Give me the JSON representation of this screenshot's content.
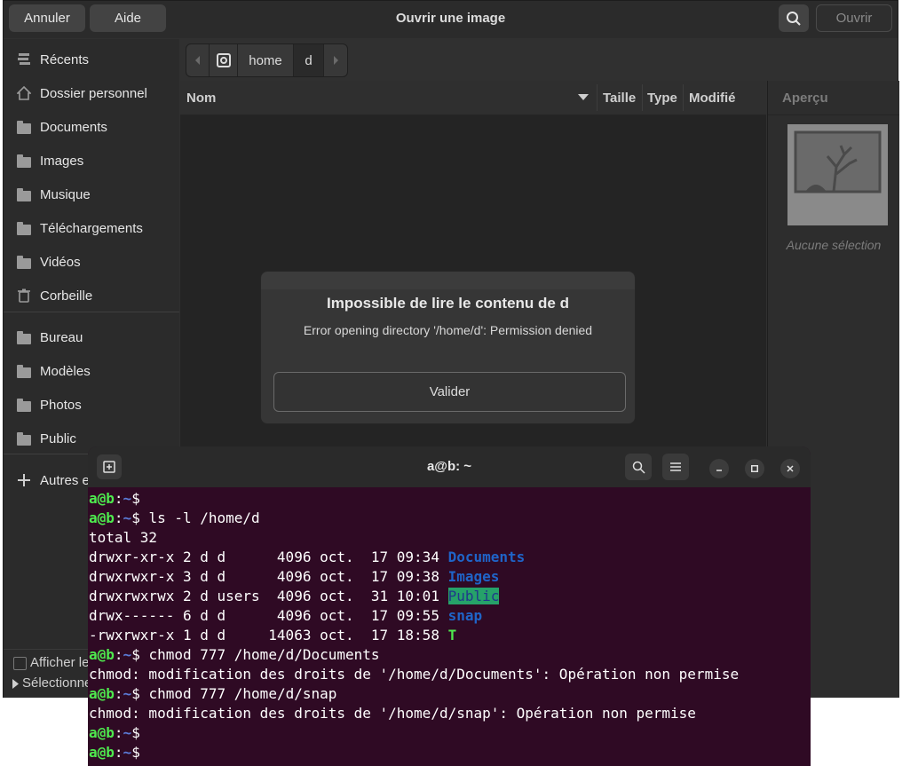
{
  "chooser": {
    "title": "Ouvrir une image",
    "cancel": "Annuler",
    "help": "Aide",
    "open": "Ouvrir",
    "sidebar": [
      {
        "label": "Récents",
        "icon": "recent-icon"
      },
      {
        "label": "Dossier personnel",
        "icon": "home-icon"
      },
      {
        "label": "Documents",
        "icon": "folder-icon"
      },
      {
        "label": "Images",
        "icon": "folder-icon"
      },
      {
        "label": "Musique",
        "icon": "folder-icon"
      },
      {
        "label": "Téléchargements",
        "icon": "folder-icon"
      },
      {
        "label": "Vidéos",
        "icon": "folder-icon"
      },
      {
        "label": "Corbeille",
        "icon": "trash-icon"
      },
      {
        "label": "Bureau",
        "icon": "folder-icon"
      },
      {
        "label": "Modèles",
        "icon": "folder-icon"
      },
      {
        "label": "Photos",
        "icon": "folder-icon"
      },
      {
        "label": "Public",
        "icon": "folder-icon"
      },
      {
        "label": "Autres emplacements",
        "icon": "plus-icon"
      }
    ],
    "path": [
      "home",
      "d"
    ],
    "columns": {
      "name": "Nom",
      "size": "Taille",
      "type": "Type",
      "modified": "Modifié"
    },
    "preview_header": "Aperçu",
    "preview_empty": "Aucune sélection",
    "show_hidden": "Afficher les fichiers cachés",
    "selection": "Sélectionner"
  },
  "dialog": {
    "title": "Impossible de lire le contenu de d",
    "message": "Error opening directory '/home/d': Permission denied",
    "button": "Valider"
  },
  "terminal": {
    "title": "a@b: ~",
    "lines": [
      {
        "type": "prompt",
        "cmd": ""
      },
      {
        "type": "prompt",
        "cmd": "ls -l /home/d"
      },
      {
        "type": "out",
        "text": "total 32"
      },
      {
        "type": "ls",
        "perms": "drwxr-xr-x 2 d d      4096 oct.  17 09:34 ",
        "name": "Documents",
        "style": "dir"
      },
      {
        "type": "ls",
        "perms": "drwxrwxr-x 3 d d      4096 oct.  17 09:38 ",
        "name": "Images",
        "style": "dir"
      },
      {
        "type": "ls",
        "perms": "drwxrwxrwx 2 d users  4096 oct.  31 10:01 ",
        "name": "Public",
        "style": "sticky"
      },
      {
        "type": "ls",
        "perms": "drwx------ 6 d d      4096 oct.  17 09:55 ",
        "name": "snap",
        "style": "dir"
      },
      {
        "type": "ls",
        "perms": "-rwxrwxr-x 1 d d     14063 oct.  17 18:58 ",
        "name": "T",
        "style": "exec"
      },
      {
        "type": "prompt",
        "cmd": "chmod 777 /home/d/Documents"
      },
      {
        "type": "out",
        "text": "chmod: modification des droits de '/home/d/Documents': Opération non permise"
      },
      {
        "type": "prompt",
        "cmd": "chmod 777 /home/d/snap"
      },
      {
        "type": "out",
        "text": "chmod: modification des droits de '/home/d/snap': Opération non permise"
      },
      {
        "type": "prompt",
        "cmd": ""
      },
      {
        "type": "prompt",
        "cmd": ""
      }
    ],
    "prompt_user": "a@b",
    "prompt_sep": ":",
    "prompt_path": "~",
    "prompt_sign": "$ "
  }
}
